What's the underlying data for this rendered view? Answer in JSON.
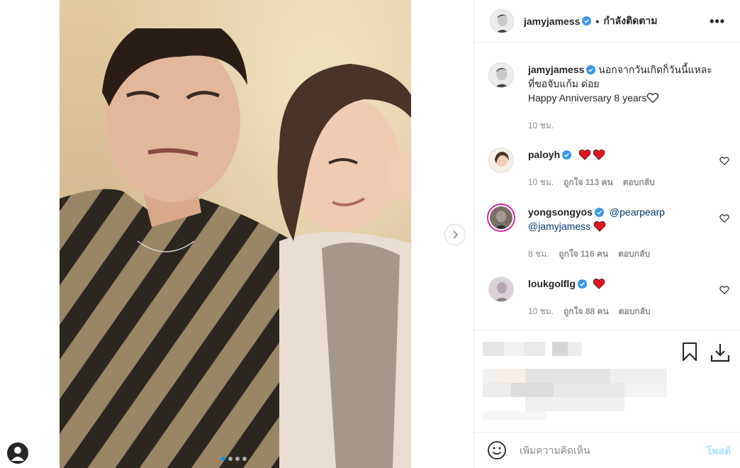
{
  "post": {
    "image_alt": "",
    "carousel_count": 4,
    "carousel_active": 1
  },
  "header": {
    "username": "jamyjamess",
    "separator": "•",
    "follow_label": "กำลังติดตาม",
    "more_label": "•••"
  },
  "caption": {
    "username": "jamyjamess",
    "text_line1": "นอกจากวันเกิดก็วันนี้แหละ",
    "text_line2": "ที่ขอจับแก้ม ด่อย",
    "text_line3": "Happy Anniversary 8 years",
    "time": "10 ชม."
  },
  "comments": [
    {
      "username": "paloyh",
      "text": "",
      "time": "10 ชม.",
      "likes": "ถูกใจ 113 คน",
      "reply": "ตอบกลับ"
    },
    {
      "username": "yongsongyos",
      "mention1": "@pearpearp",
      "mention2": "@jamyjamess",
      "time": "8 ชม.",
      "likes": "ถูกใจ 116 คน",
      "reply": "ตอบกลับ"
    },
    {
      "username": "loukgolflg",
      "text": "",
      "time": "10 ชม.",
      "likes": "ถูกใจ 88 คน",
      "reply": "ตอบกลับ"
    }
  ],
  "add_comment": {
    "placeholder": "เพิ่มความคิดเห็น",
    "post_label": "โพสต์"
  },
  "blurred_time": "10 ชั่วโมงที่แล้ว",
  "colors": {
    "accent": "#0095f6",
    "verified": "#3897f0",
    "heart": "#ed4956",
    "post_disabled": "#b2dffc"
  },
  "icons": [
    "verified-badge-icon",
    "heart-outline-icon",
    "red-heart-icon",
    "bookmark-icon",
    "download-icon",
    "smiley-icon",
    "chevron-right-icon",
    "user-avatar-icon"
  ]
}
